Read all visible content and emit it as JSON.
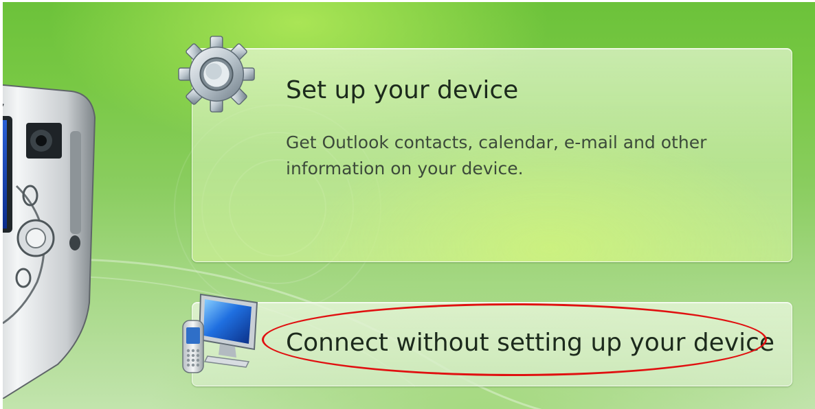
{
  "options": [
    {
      "title": "Set up your device",
      "description": "Get Outlook contacts, calendar, e-mail and other information on your device.",
      "icon": "gear-icon"
    },
    {
      "title": "Connect without setting up your device",
      "icon": "computer-and-phone-icon"
    }
  ],
  "annotation": {
    "type": "red-ellipse-highlight",
    "target": "Connect without setting up your device",
    "color": "#e01010"
  },
  "colors": {
    "background_green": "#78c844",
    "card_tint": "#dff2cc",
    "title_text": "#1c2a1c"
  }
}
